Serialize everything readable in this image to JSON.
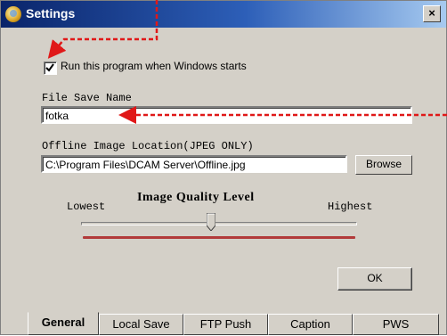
{
  "window": {
    "title": "Settings",
    "close_glyph": "×"
  },
  "startup": {
    "label": "Run this program when Windows starts",
    "checked": true
  },
  "file_save": {
    "label": "File Save Name",
    "value": "fotka"
  },
  "offline": {
    "label": "Offline Image Location(JPEG ONLY)",
    "value": "C:\\Program Files\\DCAM Server\\Offline.jpg",
    "browse_label": "Browse"
  },
  "quality": {
    "title": "Image Quality Level",
    "low_label": "Lowest",
    "high_label": "Highest",
    "level": 0.47
  },
  "ok_label": "OK",
  "tabs": [
    {
      "label": "General",
      "active": true
    },
    {
      "label": "Local Save",
      "active": false
    },
    {
      "label": "FTP Push",
      "active": false
    },
    {
      "label": "Caption",
      "active": false
    },
    {
      "label": "PWS",
      "active": false
    }
  ],
  "colors": {
    "annotation_red": "#e01818",
    "titlebar_start": "#0a246a",
    "titlebar_end": "#a6caf0",
    "face": "#d4d0c8"
  },
  "icons": {
    "app": "settings-app-icon",
    "close": "close-icon",
    "check": "checkmark-icon"
  }
}
